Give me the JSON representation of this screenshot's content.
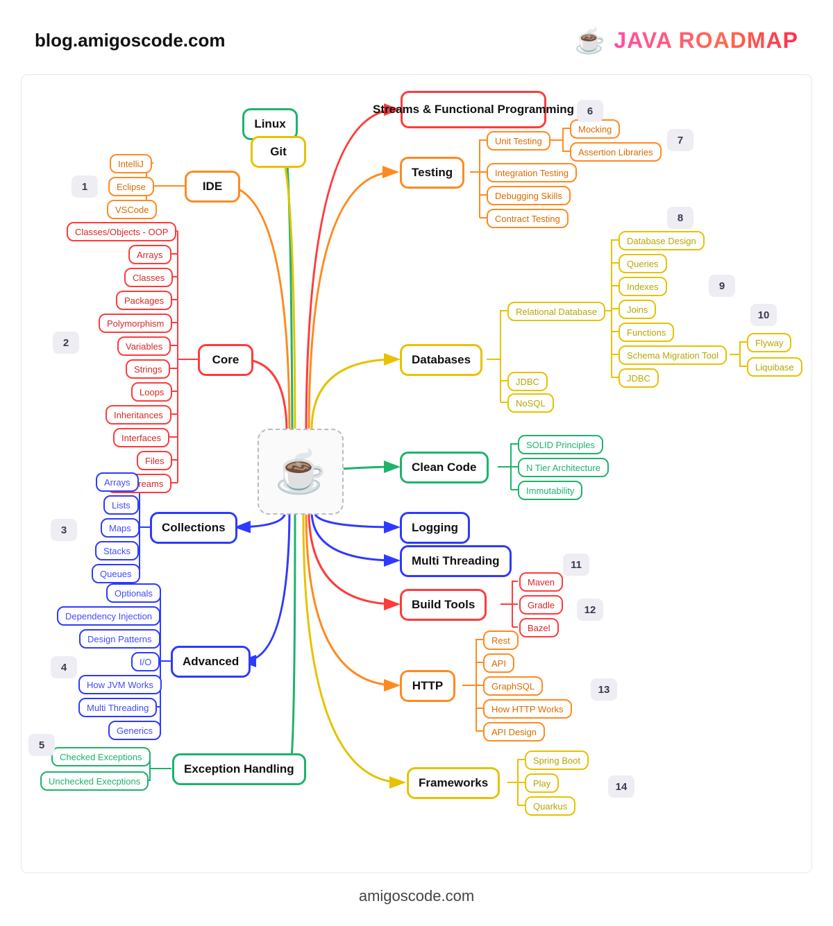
{
  "header": {
    "blog": "blog.amigoscode.com",
    "title": "JAVA ROADMAP",
    "java_logo": "☕"
  },
  "footer": "amigoscode.com",
  "left": {
    "linux": "Linux",
    "git": "Git",
    "ide": "IDE",
    "ide_opts": [
      "IntelliJ",
      "Eclipse",
      "VSCode"
    ],
    "core": "Core",
    "core_opts": [
      "Classes/Objects - OOP",
      "Arrays",
      "Classes",
      "Packages",
      "Polymorphism",
      "Variables",
      "Strings",
      "Loops",
      "Inheritances",
      "Interfaces",
      "Files",
      "I/O Streams"
    ],
    "collections": "Collections",
    "coll_opts": [
      "Arrays",
      "Lists",
      "Maps",
      "Stacks",
      "Queues"
    ],
    "advanced": "Advanced",
    "adv_opts": [
      "Optionals",
      "Dependency Injection",
      "Design Patterns",
      "I/O",
      "How JVM Works",
      "Multi Threading",
      "Generics"
    ],
    "exh": "Exception Handling",
    "exh_opts": [
      "Checked Exceptions",
      "Unchecked Execptions"
    ]
  },
  "right": {
    "streams": "Streams & Functional Programming",
    "testing": "Testing",
    "testing_opts": [
      "Unit Testing",
      "Integration Testing",
      "Debugging Skills",
      "Contract Testing"
    ],
    "unit_sub": [
      "Mocking",
      "Assertion Libraries"
    ],
    "db": "Databases",
    "db_opts": [
      "Relational Database",
      "JDBC",
      "NoSQL"
    ],
    "rel_opts": [
      "Database Design",
      "Queries",
      "Indexes",
      "Joins",
      "Functions",
      "Schema Migration Tool",
      "JDBC"
    ],
    "mig_opts": [
      "Flyway",
      "Liquibase"
    ],
    "clean": "Clean Code",
    "clean_opts": [
      "SOLID Principles",
      "N Tier Architecture",
      "Immutability"
    ],
    "logging": "Logging",
    "multi": "Multi Threading",
    "build": "Build Tools",
    "build_opts": [
      "Maven",
      "Gradle",
      "Bazel"
    ],
    "http": "HTTP",
    "http_opts": [
      "Rest",
      "API",
      "GraphSQL",
      "How HTTP Works",
      "API Design"
    ],
    "fw": "Frameworks",
    "fw_opts": [
      "Spring Boot",
      "Play",
      "Quarkus"
    ]
  },
  "badges": [
    "1",
    "2",
    "3",
    "4",
    "5",
    "6",
    "7",
    "8",
    "9",
    "10",
    "11",
    "12",
    "13",
    "14"
  ]
}
